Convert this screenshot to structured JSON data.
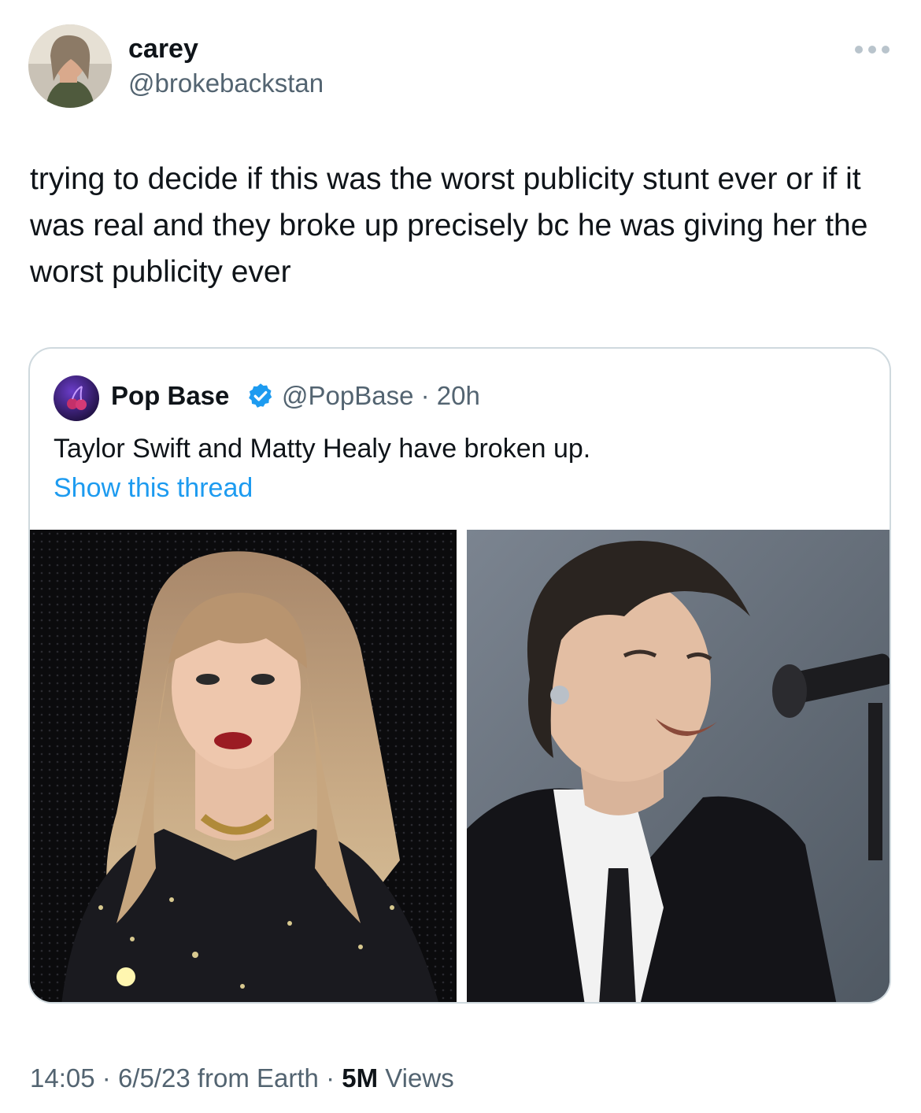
{
  "tweet": {
    "display_name": "carey",
    "handle": "@brokebackstan",
    "avatar_icon": "user-avatar-photo",
    "more_icon": "more-dots-icon",
    "text": "trying to decide if this was the worst publicity stunt ever or if it was real and they broke up precisely bc he was giving her the worst publicity ever"
  },
  "quote": {
    "display_name": "Pop Base",
    "verified_icon": "verified-badge-icon",
    "verified_color": "#1d9bf0",
    "handle": "@PopBase",
    "separator": "·",
    "time": "20h",
    "text": "Taylor Swift and Matty Healy have broken up.",
    "show_thread_label": "Show this thread",
    "link_color": "#1d9bf0",
    "photos": [
      {
        "icon": "performer-photo-left"
      },
      {
        "icon": "performer-photo-right"
      }
    ]
  },
  "footer": {
    "time": "14:05",
    "sep1": "·",
    "date": "6/5/23",
    "source": "from Earth",
    "sep2": "·",
    "views_count": "5M",
    "views_label": "Views"
  }
}
